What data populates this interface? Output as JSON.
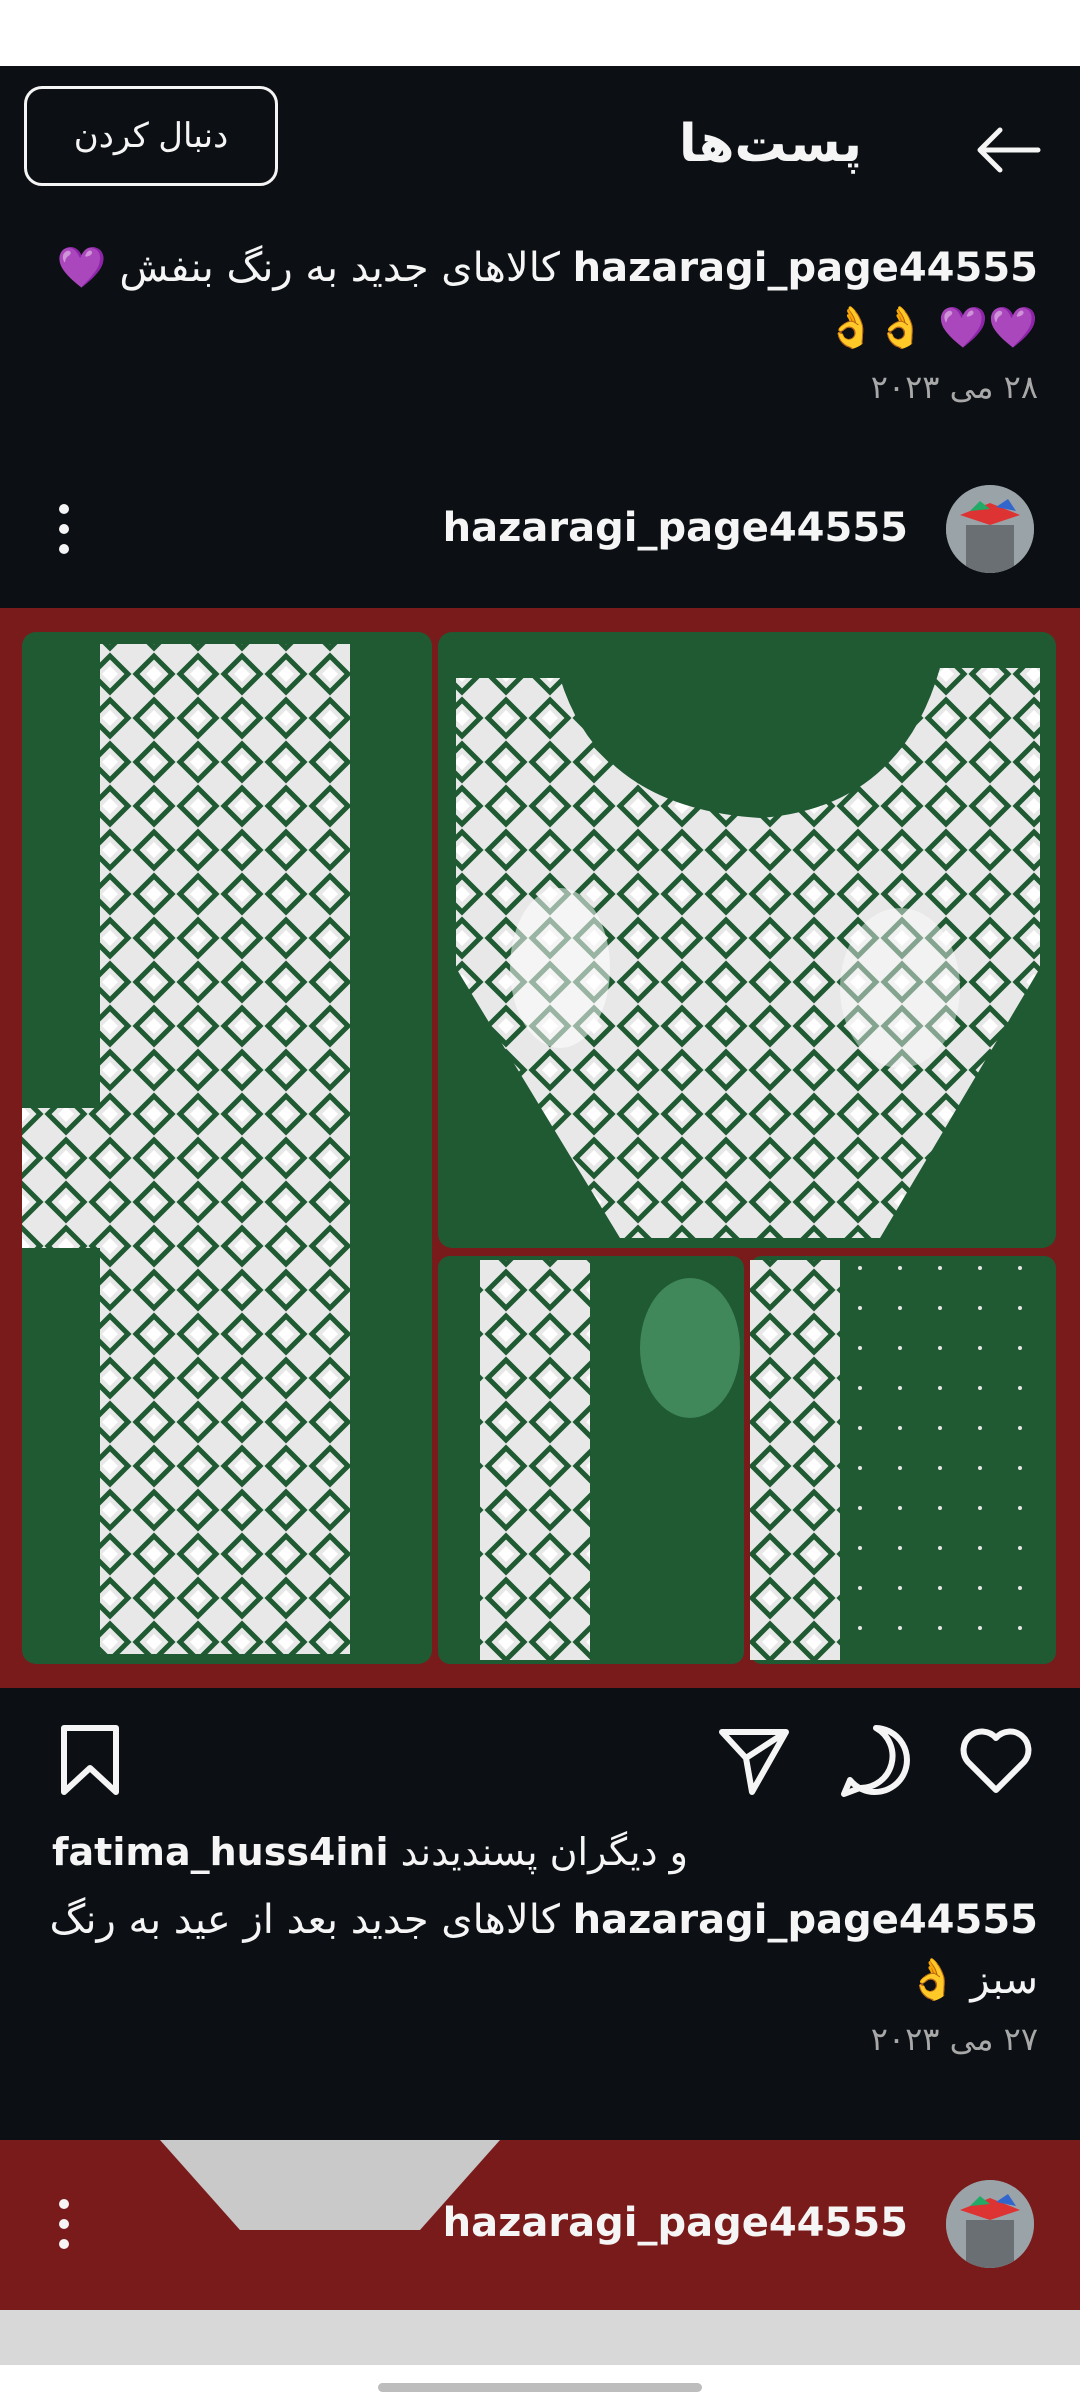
{
  "header": {
    "title": "پست‌ها",
    "follow_label": "دنبال کردن"
  },
  "top_post": {
    "username": "hazaragi_page44555",
    "caption": "کالاهای جدید به رنگ بنفش",
    "caption_emoji": "💜💜💜 👌👌",
    "date": "۲۸ می ۲۰۲۳"
  },
  "post": {
    "username": "hazaragi_page44555",
    "liked_by": "fatima_huss4ini",
    "liked_text": "و دیگران پسندیدند",
    "caption_user": "hazaragi_page44555",
    "caption": "کالاهای جدید بعد از عید به رنگ سبز",
    "caption_emoji": "👌",
    "date": "۲۷ می ۲۰۲۳"
  },
  "next_post": {
    "username": "hazaragi_page44555"
  },
  "icons": {
    "back": "arrow-left-icon",
    "more": "vertical-dots-icon",
    "like": "heart-icon",
    "comment": "comment-bubble-icon",
    "share": "paper-plane-icon",
    "save": "bookmark-icon"
  },
  "colors": {
    "background": "#0c1014",
    "text": "#f5f5f5",
    "muted": "#a8a8a8",
    "fabric_green": "#1f5a33",
    "fabric_red": "#7a1b1b",
    "purple_heart": "#b23cf5"
  }
}
